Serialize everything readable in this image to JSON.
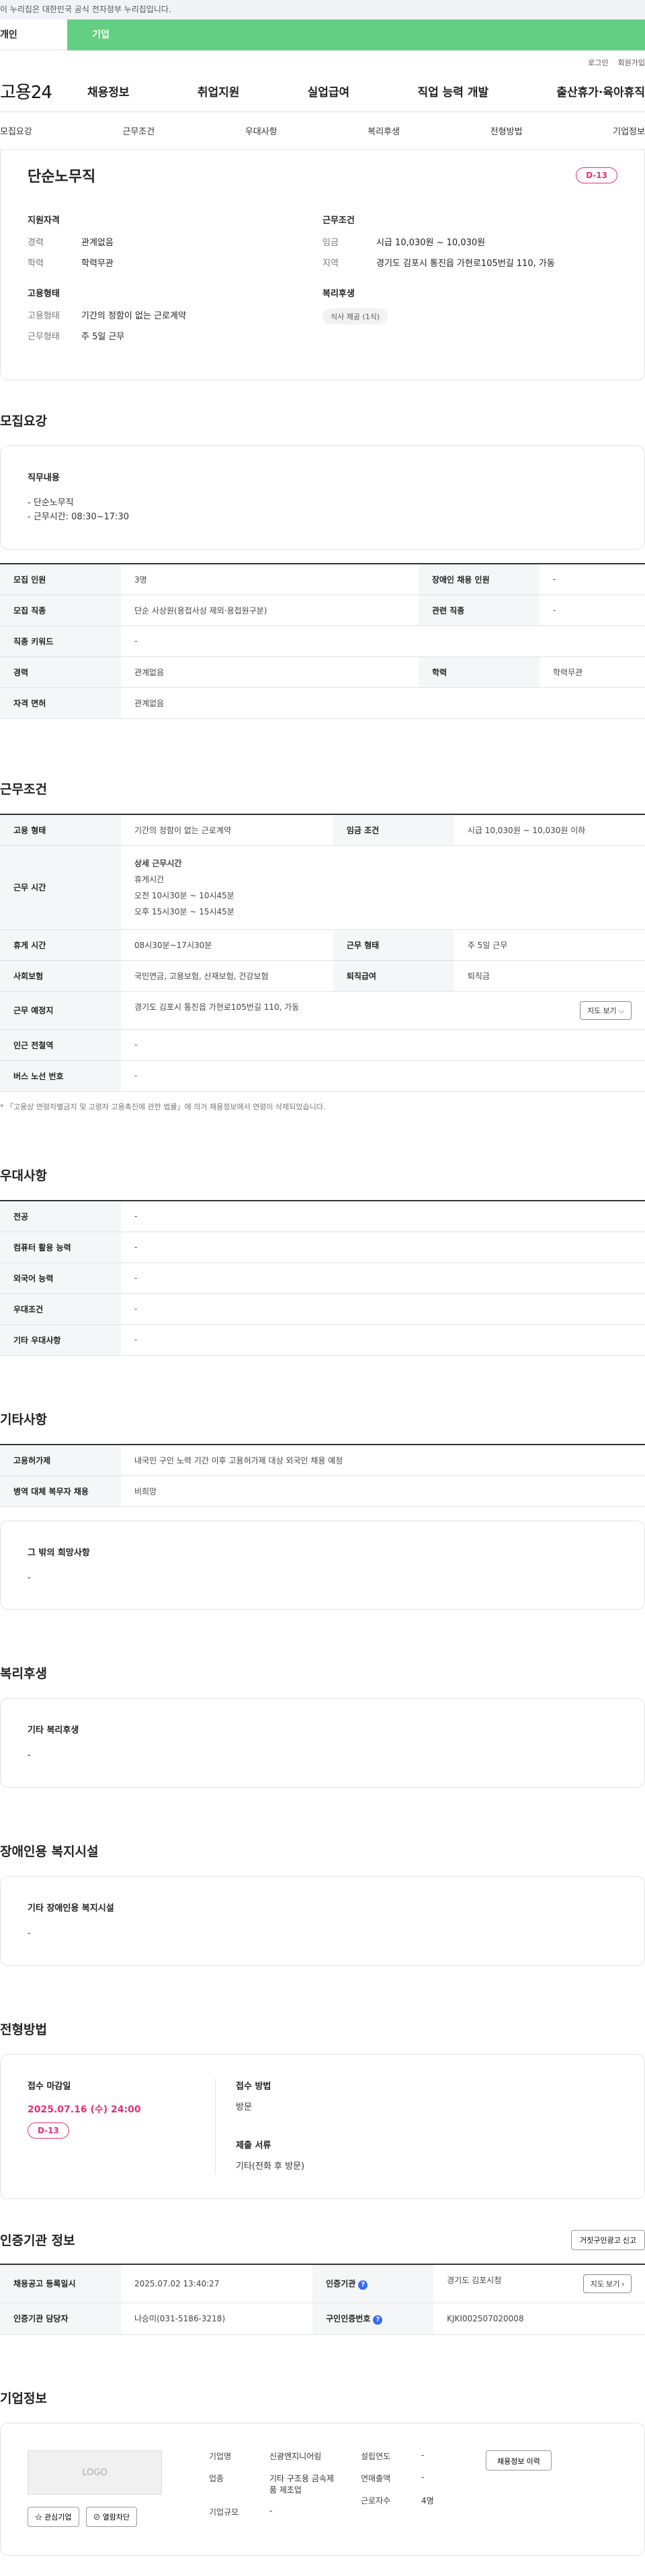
{
  "banner": "이 누리집은 대한민국 공식 전자정부 누리집입니다.",
  "tabs": {
    "person": "개인",
    "company": "기업"
  },
  "util": {
    "login": "로그인",
    "join": "회원가입"
  },
  "logo": "고용24",
  "gnb": [
    "채용정보",
    "취업지원",
    "실업급여",
    "직업 능력 개발",
    "출산휴가·육아휴직"
  ],
  "subnav": [
    "모집요강",
    "근무조건",
    "우대사항",
    "복리후생",
    "전형방법",
    "기업정보"
  ],
  "summary": {
    "title": "단순노무직",
    "dday": "D-13",
    "qual_label": "지원자격",
    "qual": [
      {
        "k": "경력",
        "v": "관계없음"
      },
      {
        "k": "학력",
        "v": "학력무관"
      }
    ],
    "work_label": "근무조건",
    "work": [
      {
        "k": "임금",
        "v": "시급 10,030원 ~ 10,030원"
      },
      {
        "k": "지역",
        "v": "경기도 김포시 통진읍 가현로105번길 110, 가동"
      }
    ],
    "emp_label": "고용형태",
    "emp": [
      {
        "k": "고용형태",
        "v": "기간의 정함이 없는 근로계약"
      },
      {
        "k": "근무형태",
        "v": "주 5일 근무"
      }
    ],
    "welfare_label": "복리후생",
    "welfare_chip": "식사 제공 (1식)"
  },
  "recruit": {
    "title": "모집요강",
    "duty_label": "직무내용",
    "duty_text": "- 단순노무직\n- 근무시간: 08:30~17:30",
    "rows": [
      [
        {
          "k": "모집 인원",
          "v": "3명"
        },
        {
          "k": "장애인 채용 인원",
          "v": "-"
        }
      ],
      [
        {
          "k": "모집 직종",
          "v": "단순 사상원(용접사상 제외·용접원구분)"
        },
        {
          "k": "관련 직종",
          "v": "-"
        }
      ],
      [
        {
          "k": "직종 키워드",
          "v": "-"
        }
      ],
      [
        {
          "k": "경력",
          "v": "관계없음"
        },
        {
          "k": "학력",
          "v": "학력무관"
        }
      ],
      [
        {
          "k": "자격 면허",
          "v": "관계없음"
        }
      ]
    ]
  },
  "work": {
    "title": "근무조건",
    "emp_k": "고용 형태",
    "emp_v": "기간의 정함이 없는 근로계약",
    "wage_k": "임금 조건",
    "wage_v": "시급 10,030원 ~ 10,030원 이하",
    "time_k": "근무 시간",
    "time_lines": [
      "상세 근무시간",
      "휴게시간",
      "오전 10시30분 ~ 10시45분",
      "오후 15시30분 ~ 15시45분"
    ],
    "break_k": "휴게 시간",
    "break_v": "08시30분~17시30분",
    "type_k": "근무 형태",
    "type_v": "주 5일 근무",
    "ins_k": "사회보험",
    "ins_v": "국민연금, 고용보험, 산재보험, 건강보험",
    "ret_k": "퇴직급여",
    "ret_v": "퇴직금",
    "place_k": "근무 예정지",
    "place_v": "경기도 김포시 통진읍 가현로105번길 110, 가동",
    "map_btn": "지도 보기 ⌵",
    "subway_k": "인근 전철역",
    "subway_v": "-",
    "bus_k": "버스 노선 번호",
    "bus_v": "-",
    "note": "* 「고용상 연령차별금지 및 고령자 고용촉진에 관한 법률」에 의거 채용정보에서 연령이 삭제되었습니다."
  },
  "pref": {
    "title": "우대사항",
    "rows": [
      {
        "k": "전공",
        "v": "-"
      },
      {
        "k": "컴퓨터 활용 능력",
        "v": "-"
      },
      {
        "k": "외국어 능력",
        "v": "-"
      },
      {
        "k": "우대조건",
        "v": "-"
      },
      {
        "k": "기타 우대사항",
        "v": "-"
      }
    ]
  },
  "etc": {
    "title": "기타사항",
    "rows": [
      {
        "k": "고용허가제",
        "v": "내국인 구인 노력 기간 이후 고용허가제 대상 외국인 채용 예정"
      },
      {
        "k": "병역 대체 복무자 채용",
        "v": "비희망"
      }
    ],
    "box_title": "그 밖의 희망사항",
    "box_text": "-"
  },
  "welfare": {
    "title": "복리후생",
    "box_title": "기타 복리후생",
    "box_text": "-"
  },
  "disabled": {
    "title": "장애인용 복지시설",
    "box_title": "기타 장애인용 복지시설",
    "box_text": "-"
  },
  "screening": {
    "title": "전형방법",
    "deadline_label": "접수 마감일",
    "deadline": "2025.07.16 (수) 24:00",
    "dday": "D-13",
    "method_label": "접수 방법",
    "method": "방문",
    "docs_label": "제출 서류",
    "docs": "기타(전화 후 방문)"
  },
  "cert": {
    "title": "인증기관 정보",
    "report_btn": "거짓구인광고 신고",
    "r1k1": "채용공고 등록일시",
    "r1v1": "2025.07.02 13:40:27",
    "r1k2": "인증기관",
    "r1v2": "경기도 김포시청",
    "map_btn": "지도 보기 ›",
    "r2k1": "인증기관 담당자",
    "r2v1": "나승미(031-5186-3218)",
    "r2k2": "구인인증번호",
    "r2v2": "KJKI002507020008",
    "q": "?"
  },
  "company": {
    "title": "기업정보",
    "logo": "LOGO",
    "fav_btn": "☆ 관심기업",
    "block_btn": "⊘ 열람차단",
    "name_k": "기업명",
    "name_v": "신광엔지니어링",
    "ind_k": "업종",
    "ind_v": "기타 구조용 금속제품 제조업",
    "size_k": "기업규모",
    "size_v": "-",
    "est_k": "설립연도",
    "est_v": "-",
    "sales_k": "연매출액",
    "sales_v": "-",
    "emp_k": "근로자수",
    "emp_v": "4명",
    "hist_btn": "채용정보 이력"
  }
}
